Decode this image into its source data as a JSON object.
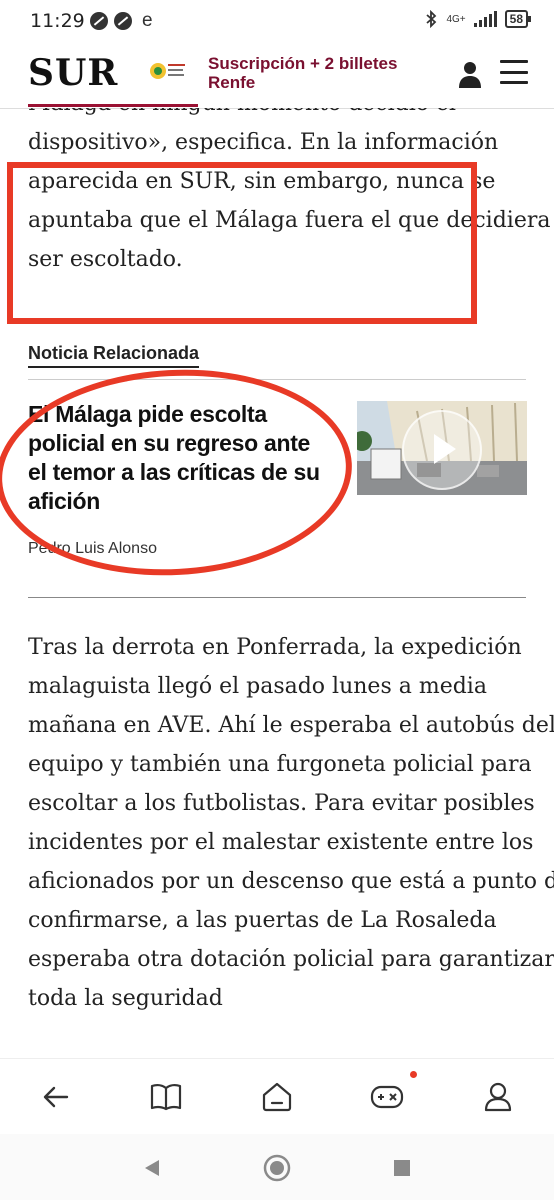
{
  "status_bar": {
    "time": "11:29",
    "extra": "e",
    "network": "4G+",
    "battery": "58"
  },
  "header": {
    "logo": "SUR",
    "promo_line1": "Suscripción + 2 billetes",
    "promo_line2": "Renfe"
  },
  "article": {
    "paragraph1": "Málaga en ningún momento decidió el dispositivo», especifica. En la información aparecida en SUR, sin embargo, nunca se apuntaba que el Málaga fuera el que decidiera ser escoltado.",
    "related": {
      "label": "Noticia Relacionada",
      "title": "El Málaga pide escolta policial en su regreso ante el temor a las críticas de su afición",
      "author": "Pedro Luis Alonso"
    },
    "paragraph2": "Tras la derrota en Ponferrada, la expedición malaguista llegó el pasado lunes a media mañana en AVE. Ahí le esperaba el autobús del equipo y también una furgoneta policial para escoltar a los futbolistas. Para evitar posibles incidentes por el malestar existente entre los aficionados por un descenso que está a punto de confirmarse, a las puertas de La Rosaleda esperaba otra dotación policial para garantizar toda la seguridad"
  },
  "colors": {
    "brand": "#7a1030",
    "annotation": "#e83a26"
  }
}
